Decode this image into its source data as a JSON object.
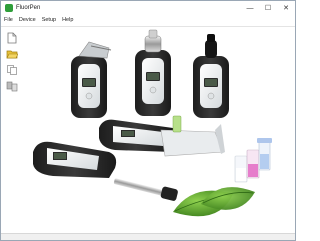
{
  "window": {
    "title": "FluorPen",
    "minimize_glyph": "—",
    "maximize_glyph": "☐",
    "close_glyph": "✕"
  },
  "menu": {
    "items": [
      {
        "label": "File"
      },
      {
        "label": "Device"
      },
      {
        "label": "Setup"
      },
      {
        "label": "Help"
      }
    ]
  },
  "toolbar": {
    "buttons": [
      {
        "icon": "new-document-icon"
      },
      {
        "icon": "open-folder-icon"
      },
      {
        "icon": "copy-icon"
      },
      {
        "icon": "device-transfer-icon"
      }
    ]
  },
  "status": {
    "text": ""
  },
  "colors": {
    "brand_green": "#2f9e3a",
    "device_black": "#2a2a2a",
    "device_white": "#eef1f2",
    "leaf_green": "#4f9a2a"
  }
}
